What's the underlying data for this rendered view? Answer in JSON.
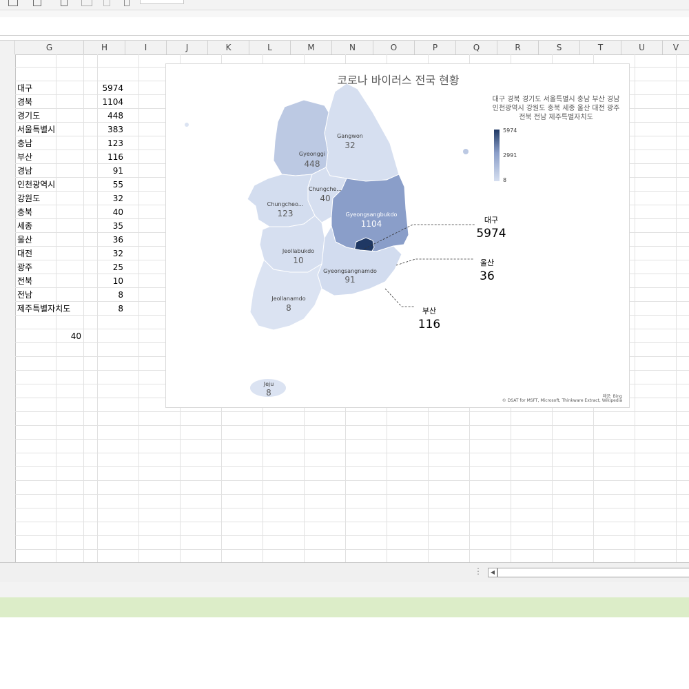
{
  "toolbar": {
    "icons": [
      "table-icon",
      "chart-icon",
      "paste-icon",
      "copy-icon",
      "brush-icon",
      "redo-icon"
    ]
  },
  "columns": [
    "G",
    "H",
    "I",
    "J",
    "K",
    "L",
    "M",
    "N",
    "O",
    "P",
    "Q",
    "R",
    "S",
    "T",
    "U",
    "V"
  ],
  "table": [
    {
      "region": "대구",
      "value": "5974"
    },
    {
      "region": "경북",
      "value": "1104"
    },
    {
      "region": "경기도",
      "value": "448"
    },
    {
      "region": "서울특별시",
      "value": "383"
    },
    {
      "region": "충남",
      "value": "123"
    },
    {
      "region": "부산",
      "value": "116"
    },
    {
      "region": "경남",
      "value": "91"
    },
    {
      "region": "인천광역시",
      "value": "55"
    },
    {
      "region": "강원도",
      "value": "32"
    },
    {
      "region": "충북",
      "value": "40"
    },
    {
      "region": "세종",
      "value": "35"
    },
    {
      "region": "울산",
      "value": "36"
    },
    {
      "region": "대전",
      "value": "32"
    },
    {
      "region": "광주",
      "value": "25"
    },
    {
      "region": "전북",
      "value": "10"
    },
    {
      "region": "전남",
      "value": "8"
    },
    {
      "region": "제주특별자치도",
      "value": "8"
    }
  ],
  "extra_cell": "40",
  "chart": {
    "title": "코로나 바이러스 전국 현황",
    "legend_title": "대구 경북 경기도 서울특별시 충남 부산 경남 인천광역시 강원도 충북 세종 울산 대전 광주 전북 전남 제주특별자치도",
    "legend_max": "5974",
    "legend_mid": "2991",
    "legend_min": "8",
    "colors": {
      "max": "#1f3864",
      "high": "#8a9ec9",
      "low": "#d6dff0"
    },
    "regions": [
      {
        "name": "Gangwon",
        "value": "32"
      },
      {
        "name": "Gyeonggi",
        "value": "448"
      },
      {
        "name": "Chungche...",
        "value": "40"
      },
      {
        "name": "Chungcheo...",
        "value": "123"
      },
      {
        "name": "Gyeongsangbukdo",
        "value": "1104"
      },
      {
        "name": "Jeollabukdo",
        "value": "10"
      },
      {
        "name": "Gyeongsangnamdo",
        "value": "91"
      },
      {
        "name": "Jeollanamdo",
        "value": "8"
      },
      {
        "name": "Jeju",
        "value": "8"
      }
    ],
    "callouts": [
      {
        "label": "대구",
        "value": "5974"
      },
      {
        "label": "울산",
        "value": "36"
      },
      {
        "label": "부산",
        "value": "116"
      }
    ],
    "credit_provider": "제공: Bing",
    "credit_sources": "© DSAT for MSFT, Microsoft, Thinkware Extract, Wikipedia"
  }
}
